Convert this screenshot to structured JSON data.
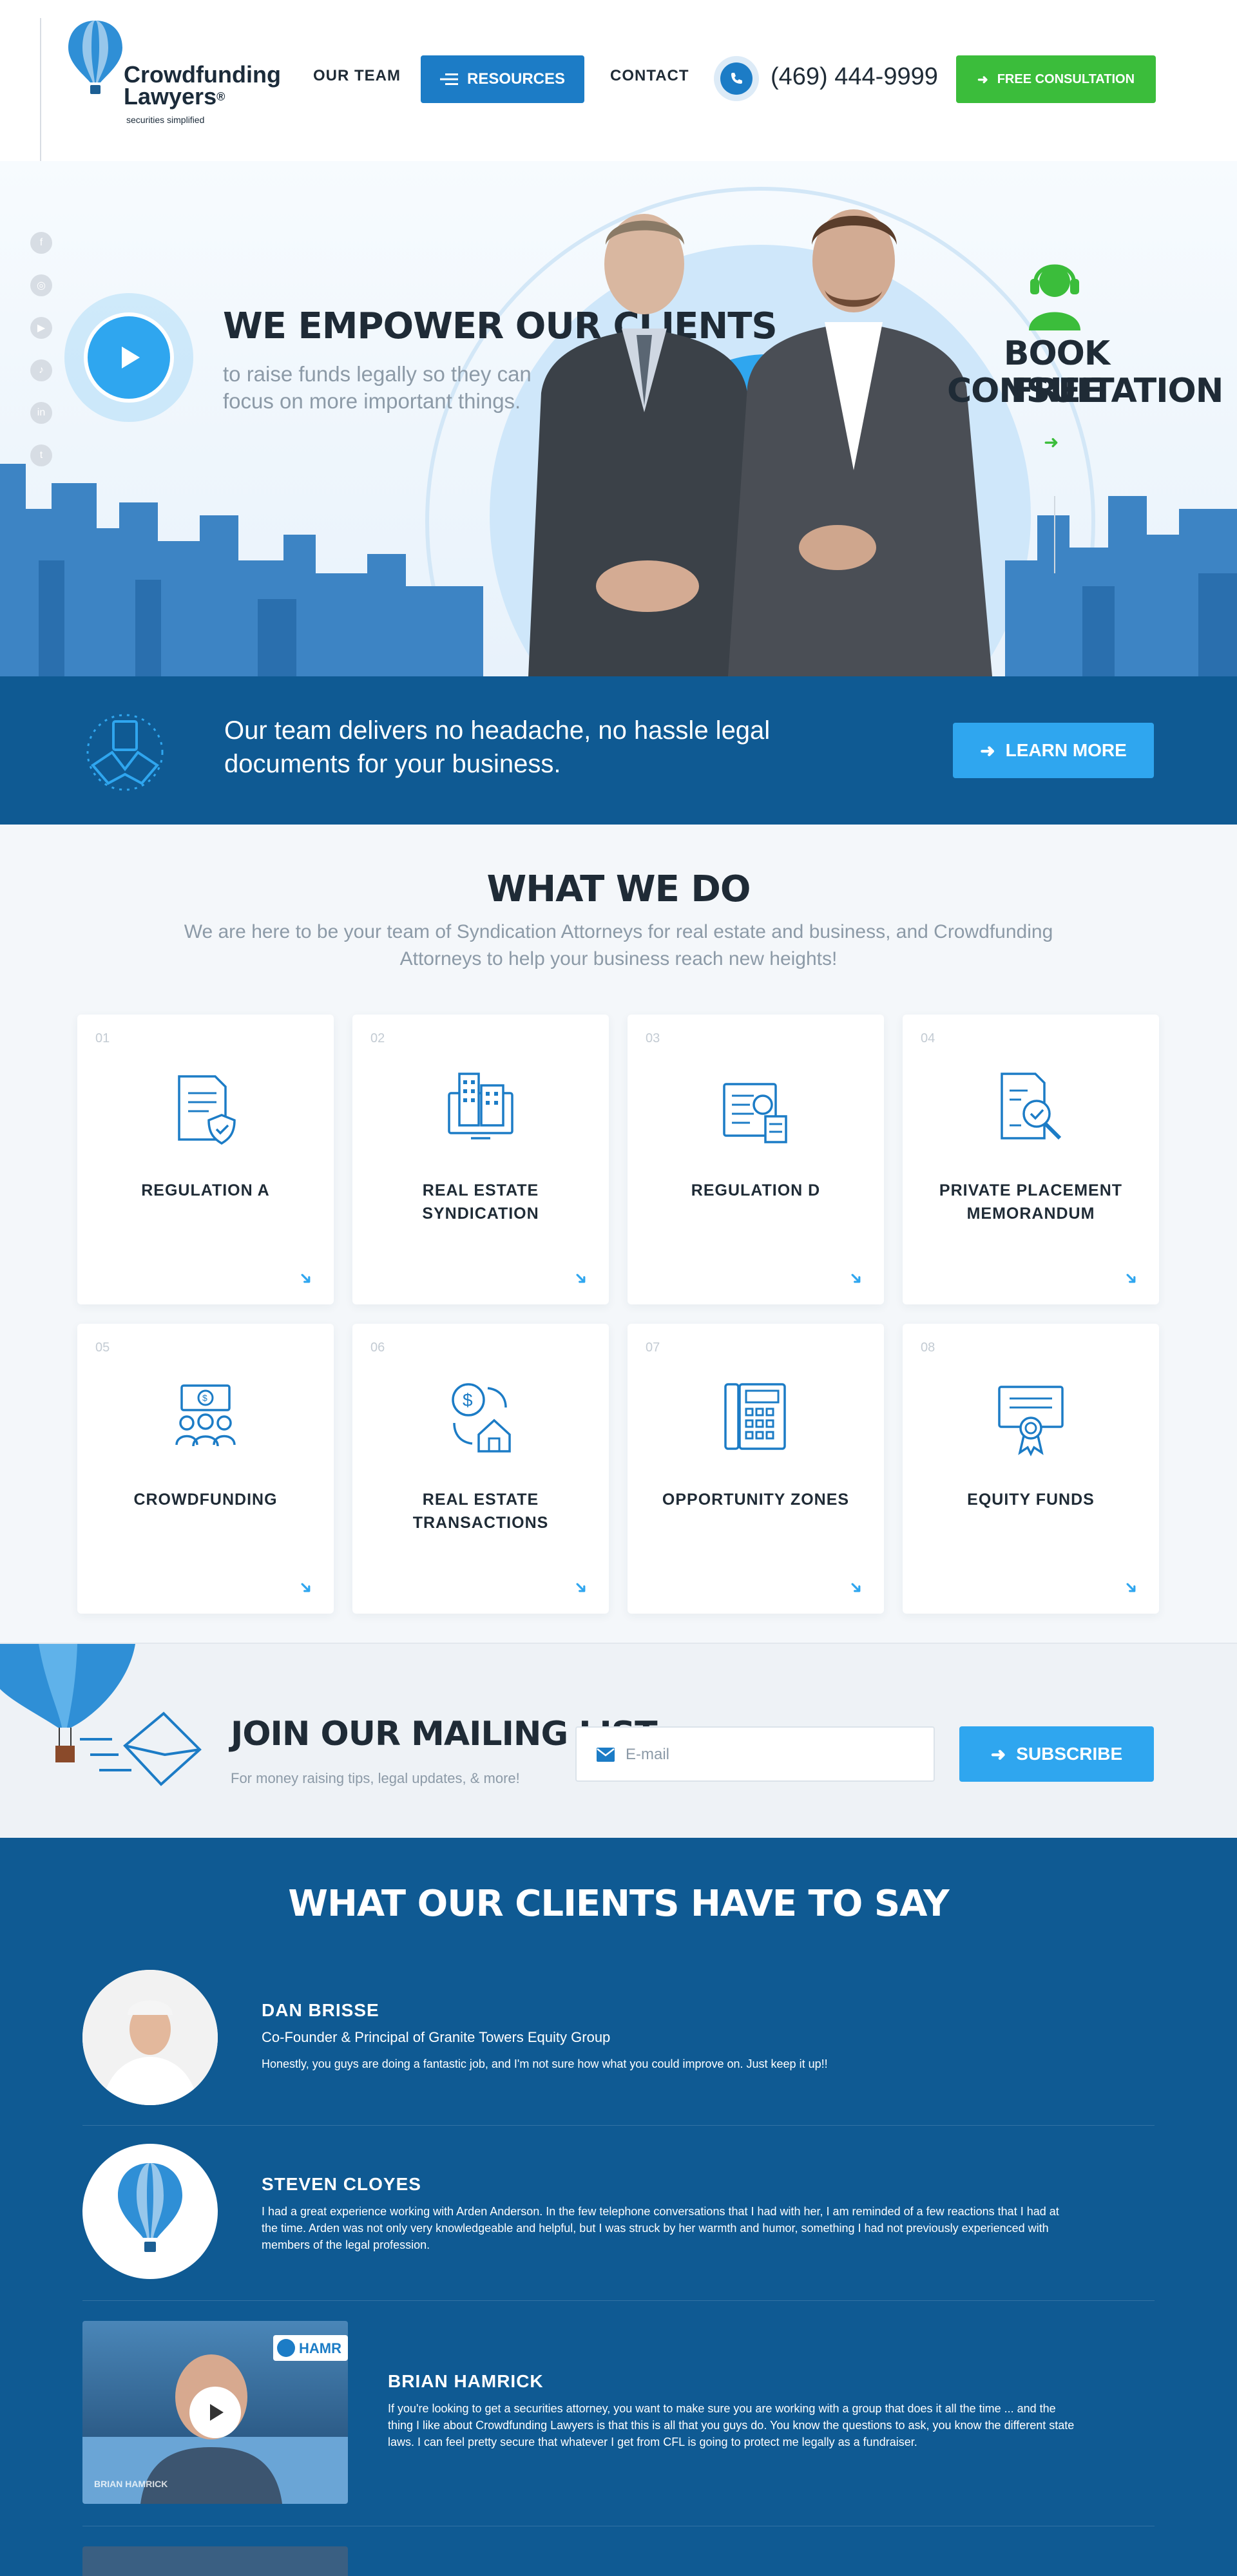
{
  "header": {
    "logo_line1": "Crowdfunding",
    "logo_line2": "Lawyers",
    "logo_reg": "®",
    "logo_tagline": "securities simplified",
    "nav": {
      "our_team": "OUR TEAM",
      "resources": "RESOURCES",
      "contact": "CONTACT"
    },
    "phone": "(469) 444-9999",
    "cta": "FREE CONSULTATION"
  },
  "hero": {
    "title": "WE EMPOWER OUR CLIENTS",
    "subtitle_line1": "to raise funds legally so they can",
    "subtitle_line2": "focus on more important things.",
    "book_line1": "BOOK FREE",
    "book_line2": "CONSULTATION",
    "social_icons": [
      "facebook-icon",
      "instagram-icon",
      "youtube-icon",
      "tiktok-icon",
      "linkedin-icon",
      "twitter-icon"
    ]
  },
  "band": {
    "text_line1": "Our team delivers no headache, no hassle legal",
    "text_line2": "documents for your business.",
    "cta": "LEARN MORE"
  },
  "what_we_do": {
    "title": "WHAT WE DO",
    "subtitle_line1": "We are here to be your team of Syndication Attorneys for real estate and business, and Crowdfunding",
    "subtitle_line2": "Attorneys to help your business reach new heights!",
    "cards": [
      {
        "num": "01",
        "line1": "REGULATION A",
        "line2": "",
        "icon": "document-shield-icon"
      },
      {
        "num": "02",
        "line1": "REAL ESTATE",
        "line2": "SYNDICATION",
        "icon": "buildings-icon"
      },
      {
        "num": "03",
        "line1": "REGULATION D",
        "line2": "",
        "icon": "document-search-icon"
      },
      {
        "num": "04",
        "line1": "PRIVATE PLACEMENT",
        "line2": "MEMORANDUM",
        "icon": "document-magnifier-icon"
      },
      {
        "num": "05",
        "line1": "CROWDFUNDING",
        "line2": "",
        "icon": "money-people-icon"
      },
      {
        "num": "06",
        "line1": "REAL ESTATE",
        "line2": "TRANSACTIONS",
        "icon": "dollar-house-icon"
      },
      {
        "num": "07",
        "line1": "OPPORTUNITY ZONES",
        "line2": "",
        "icon": "calculator-icon"
      },
      {
        "num": "08",
        "line1": "EQUITY FUNDS",
        "line2": "",
        "icon": "certificate-icon"
      }
    ]
  },
  "mailing": {
    "title": "JOIN OUR MAILING LIST",
    "subtitle": "For money raising tips, legal updates, & more!",
    "placeholder": "E-mail",
    "cta": "SUBSCRIBE"
  },
  "testimonials": {
    "title": "WHAT OUR CLIENTS HAVE TO SAY",
    "items": [
      {
        "name": "DAN BRISSE",
        "role": "Co-Founder & Principal of Granite Towers Equity Group",
        "quote": "Honestly, you guys are doing a fantastic job, and I'm not sure how what you could improve on. Just keep it up!!"
      },
      {
        "name": "STEVEN CLOYES",
        "role": "",
        "quote_line1": "I had a great experience working with Arden Anderson. In the few telephone conversations that I had with her, I am reminded of a few reactions that I had at",
        "quote_line2": "the time. Arden was not only very knowledgeable and helpful, but I was struck by her warmth and humor, something I had not previously experienced with",
        "quote_line3": "members of the legal profession."
      },
      {
        "name": "BRIAN HAMRICK",
        "quote_line1": "If you're looking to get a securities attorney, you want to make sure you are working with a group that does it all the time ... and the",
        "quote_line2": "thing I like about Crowdfunding Lawyers is that this is all that you guys do. You know the questions to ask, you know the different state",
        "quote_line3": "laws. I can feel pretty secure that whatever I get from CFL is going to protect me legally as a fundraiser.",
        "video_caption": "BRIAN HAMRICK",
        "video_badge": "HAMR"
      }
    ]
  },
  "colors": {
    "blue": "#1c7cc6",
    "light_blue": "#2fa6ef",
    "green": "#3bbd3b",
    "navy": "#0f5a93",
    "dark_text": "#1f2b36"
  }
}
